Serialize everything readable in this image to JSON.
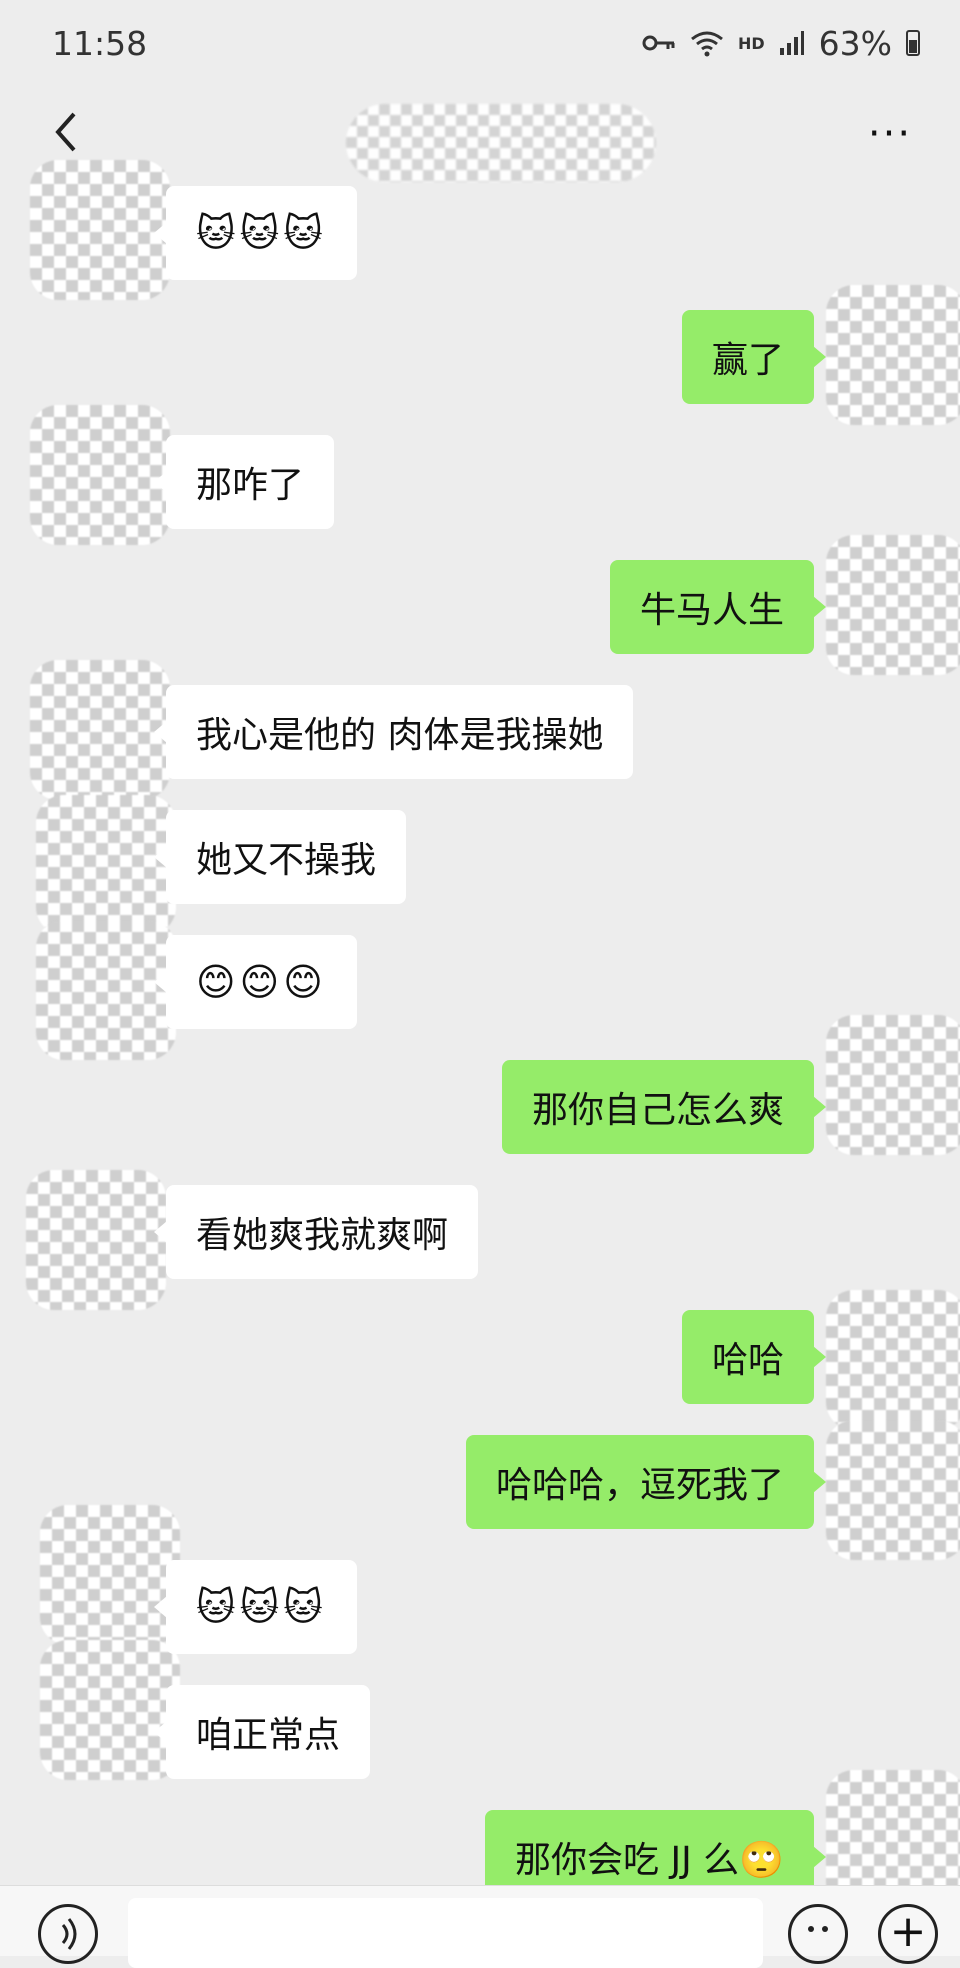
{
  "status_bar": {
    "time": "11:58",
    "network": "HD",
    "battery": "63%",
    "icons": [
      "key-icon",
      "wifi-icon",
      "signal-icon",
      "battery-icon"
    ]
  },
  "nav": {
    "back_icon": "chevron-left-icon",
    "more_icon": "more-dots-icon",
    "more_label": "···"
  },
  "messages": [
    {
      "side": "left",
      "text": "🐱🐱🐱"
    },
    {
      "side": "right",
      "text": "赢了"
    },
    {
      "side": "left",
      "text": "那咋了"
    },
    {
      "side": "right",
      "text": "牛马人生"
    },
    {
      "side": "left",
      "text": "我心是他的 肉体是我操她"
    },
    {
      "side": "left",
      "text": "她又不操我"
    },
    {
      "side": "left",
      "text": "😊😊😊"
    },
    {
      "side": "right",
      "text": "那你自己怎么爽"
    },
    {
      "side": "left",
      "text": "看她爽我就爽啊"
    },
    {
      "side": "right",
      "text": "哈哈"
    },
    {
      "side": "right",
      "text": "哈哈哈，逗死我了"
    },
    {
      "side": "left",
      "text": "🐱🐱🐱"
    },
    {
      "side": "left",
      "text": "咱正常点"
    },
    {
      "side": "right",
      "text": "那你会吃 JJ 么🙄"
    }
  ],
  "colors": {
    "background": "#ededed",
    "incoming_bubble": "#ffffff",
    "outgoing_bubble": "#95ec69"
  },
  "input_bar": {
    "voice_icon": "voice-icon",
    "emoji_icon": "emoji-icon",
    "plus_icon": "plus-icon",
    "plus_label": "+"
  }
}
